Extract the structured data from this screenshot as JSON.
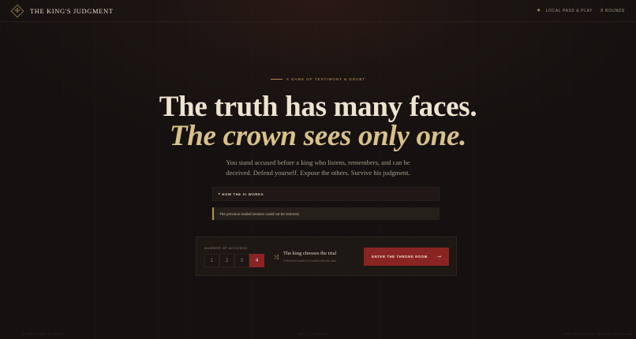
{
  "header": {
    "brand": "THE KING'S JUDGMENT",
    "mode": "LOCAL PASS & PLAY",
    "separator": "·",
    "rounds": "8 ROUNDS"
  },
  "hero": {
    "eyebrow": "A GAME OF TESTIMONY & DOUBT",
    "headline": "The truth has many faces.",
    "subheadline": "The crown sees only one.",
    "lede": "You stand accused before a king who listens, remembers, and can be deceived. Defend yourself. Expose the others. Survive his judgment."
  },
  "ai_disclosure": {
    "caret": "▸",
    "label": "HOW THE AI WORKS"
  },
  "notice": {
    "message": "The previous sealed session could not be restored."
  },
  "setup": {
    "count_label": "NUMBER OF ACCUSED",
    "options": [
      "1",
      "2",
      "3",
      "4"
    ],
    "selected": "4",
    "trial_title": "The king chooses the trial",
    "trial_sub": "Unfinished results is revealed with the case",
    "enter_label": "ENTER THE THRONE ROOM",
    "enter_arrow": "→"
  },
  "footer": {
    "left": "EVERY CASE IS NEW",
    "center": "API · 1.0 READY",
    "right": "REFRESH SAFE SEALED SESSIONS"
  },
  "colors": {
    "accent_gold": "#c9a35e",
    "accent_red": "#8a2423",
    "background": "#1b1412"
  }
}
